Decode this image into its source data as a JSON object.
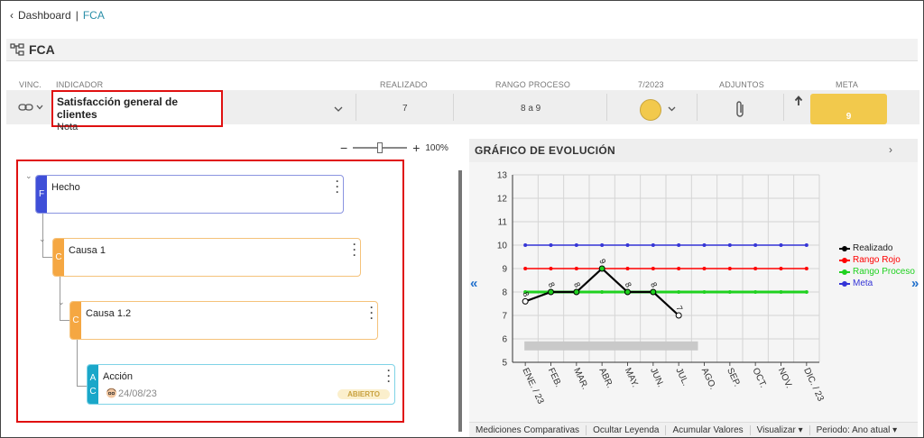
{
  "breadcrumb": {
    "parent": "Dashboard",
    "separator": "|",
    "current": "FCA"
  },
  "page": {
    "title": "FCA"
  },
  "table": {
    "headers": {
      "vinc": "VINC.",
      "indicador": "INDICADOR",
      "realizado": "REALIZADO",
      "rango": "RANGO PROCESO",
      "period": "7/2023",
      "adjuntos": "ADJUNTOS",
      "meta": "META"
    },
    "row": {
      "indicator_name": "Satisfacción general de clientes",
      "indicator_sub": "Nota",
      "realizado": "7",
      "rango": "8 a 9",
      "status_color": "#f2c94c",
      "meta": "9"
    }
  },
  "zoom": {
    "minus": "−",
    "plus": "+",
    "value": "100%",
    "level": 0.5
  },
  "tree": {
    "hecho": {
      "tag": "F",
      "label": "Hecho",
      "color": "#3f4fd8"
    },
    "causa1": {
      "tag": "C",
      "label": "Causa 1",
      "color": "#f5a742"
    },
    "causa12": {
      "tag": "C",
      "label": "Causa 1.2",
      "color": "#f5a742"
    },
    "accion": {
      "tag_top": "A",
      "tag_bottom": "C",
      "label": "Acción",
      "date": "24/08/23",
      "status": "ABIERTO",
      "color": "#1aa7c9"
    }
  },
  "chart_panel": {
    "title": "GRÁFICO DE EVOLUCIÓN",
    "expand_icon": "chevron-right-icon",
    "left_arrow": "«",
    "right_arrow": "»"
  },
  "chart_data": {
    "type": "line",
    "categories": [
      "ENE. / 23",
      "FEB.",
      "MAR.",
      "ABR.",
      "MAY.",
      "JUN.",
      "JUL.",
      "AGO.",
      "SEP.",
      "OCT.",
      "NOV.",
      "DIC. / 23"
    ],
    "ylim": [
      5,
      13
    ],
    "yticks": [
      "5",
      "6",
      "7",
      "8",
      "9",
      "10",
      "11",
      "12",
      "13"
    ],
    "series": [
      {
        "name": "Realizado",
        "color": "#000000",
        "values": [
          7.6,
          8,
          8,
          9,
          8,
          8,
          7,
          null,
          null,
          null,
          null,
          null
        ],
        "labels": [
          "8",
          "8",
          "8",
          "9",
          "8",
          "8",
          "7"
        ]
      },
      {
        "name": "Rango Rojo",
        "color": "#ff0000",
        "values": [
          9,
          9,
          9,
          9,
          9,
          9,
          9,
          9,
          9,
          9,
          9,
          9
        ]
      },
      {
        "name": "Rango Proceso",
        "color": "#1fd11f",
        "values": [
          8,
          8,
          8,
          8,
          8,
          8,
          8,
          8,
          8,
          8,
          8,
          8
        ]
      },
      {
        "name": "Meta",
        "color": "#3535d6",
        "values": [
          10,
          10,
          10,
          10,
          10,
          10,
          10,
          10,
          10,
          10,
          10,
          10
        ]
      }
    ],
    "band": {
      "from_category": 0,
      "to_category": 7,
      "value": 5.7
    },
    "grid": true,
    "legend": "right"
  },
  "bottom_bar": {
    "items": [
      "Mediciones Comparativas",
      "Ocultar Leyenda",
      "Acumular Valores",
      "Visualizar ▾",
      "Periodo: Ano atual ▾"
    ]
  }
}
